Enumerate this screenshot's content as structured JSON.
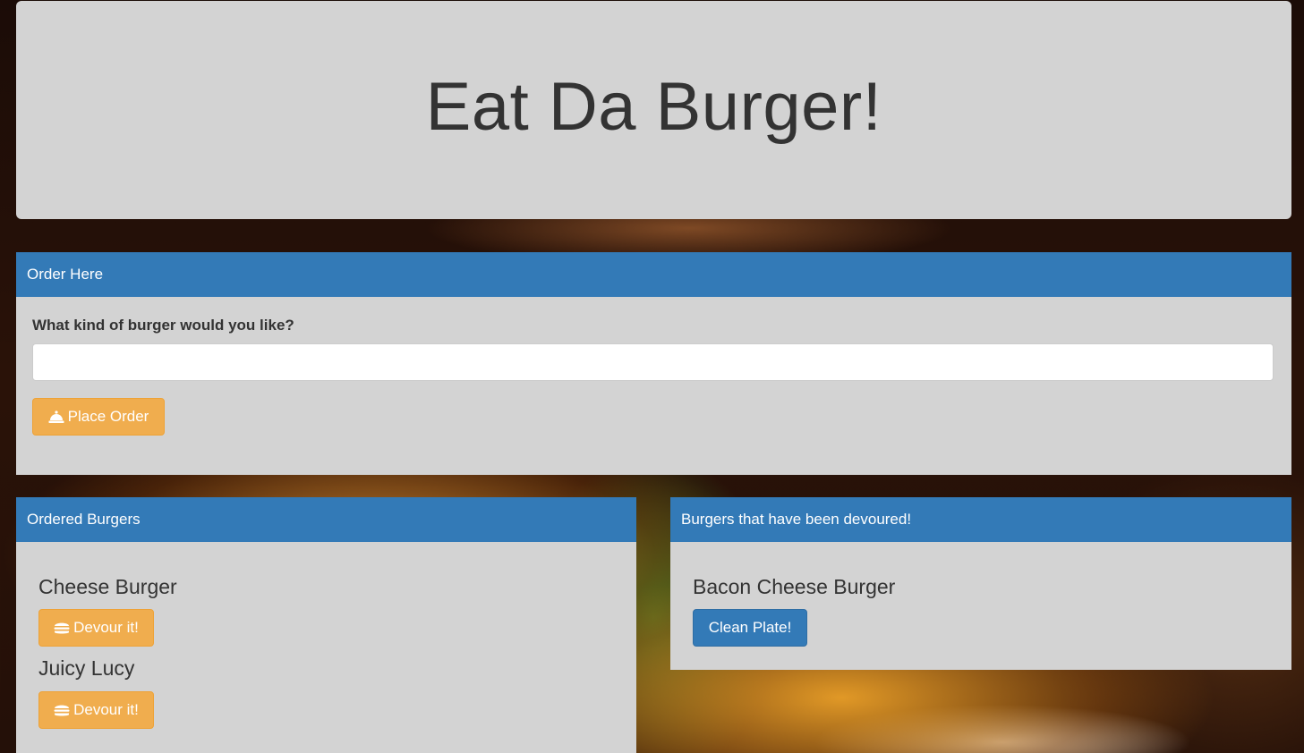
{
  "header": {
    "title": "Eat Da Burger!"
  },
  "order_panel": {
    "heading": "Order Here",
    "label": "What kind of burger would you like?",
    "input_value": "",
    "input_placeholder": "",
    "button_label": "Place Order",
    "button_icon": "bell-icon"
  },
  "ordered_panel": {
    "heading": "Ordered Burgers",
    "items": [
      {
        "name": "Cheese Burger",
        "button_label": "Devour it!",
        "button_icon": "burger-icon"
      },
      {
        "name": "Juicy Lucy",
        "button_label": "Devour it!",
        "button_icon": "burger-icon"
      }
    ]
  },
  "devoured_panel": {
    "heading": "Burgers that have been devoured!",
    "items": [
      {
        "name": "Bacon Cheese Burger",
        "button_label": "Clean Plate!"
      }
    ]
  },
  "colors": {
    "primary": "#337ab7",
    "warning": "#f0ad4e",
    "panel_body": "#d3d3d3"
  }
}
